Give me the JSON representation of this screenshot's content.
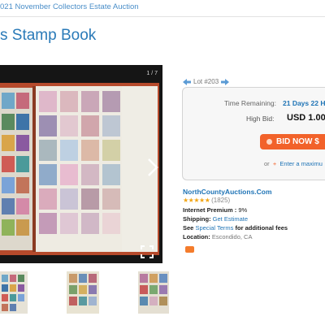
{
  "breadcrumb": "021 November Collectors Estate Auction",
  "page_title": "s Stamp Book",
  "gallery": {
    "counter": "1 / 7"
  },
  "lot": {
    "label": "Lot #203"
  },
  "bid": {
    "time_remaining_label": "Time Remaining:",
    "time_remaining_value": "21 Days 22 H",
    "high_bid_label": "High Bid:",
    "high_bid_value": "USD 1.00",
    "bid_button": "BID NOW $",
    "or_text": "or",
    "max_link": "Enter a maximu"
  },
  "seller": {
    "name": "NorthCountyAuctions.Com",
    "stars": "★★★★★",
    "reviews": "(1825)",
    "premium_label": "Internet Premium :",
    "premium_value": "9%",
    "shipping_label": "Shipping:",
    "shipping_value": "Get Estimate",
    "see_label": "See",
    "special_terms_link": "Special Terms",
    "see_suffix": "for additional fees",
    "location_label": "Location:",
    "location_value": "Escondido, CA"
  },
  "colors": {
    "accent": "#1f74b6",
    "bid_button": "#f2622a",
    "stars": "#f2a514"
  }
}
